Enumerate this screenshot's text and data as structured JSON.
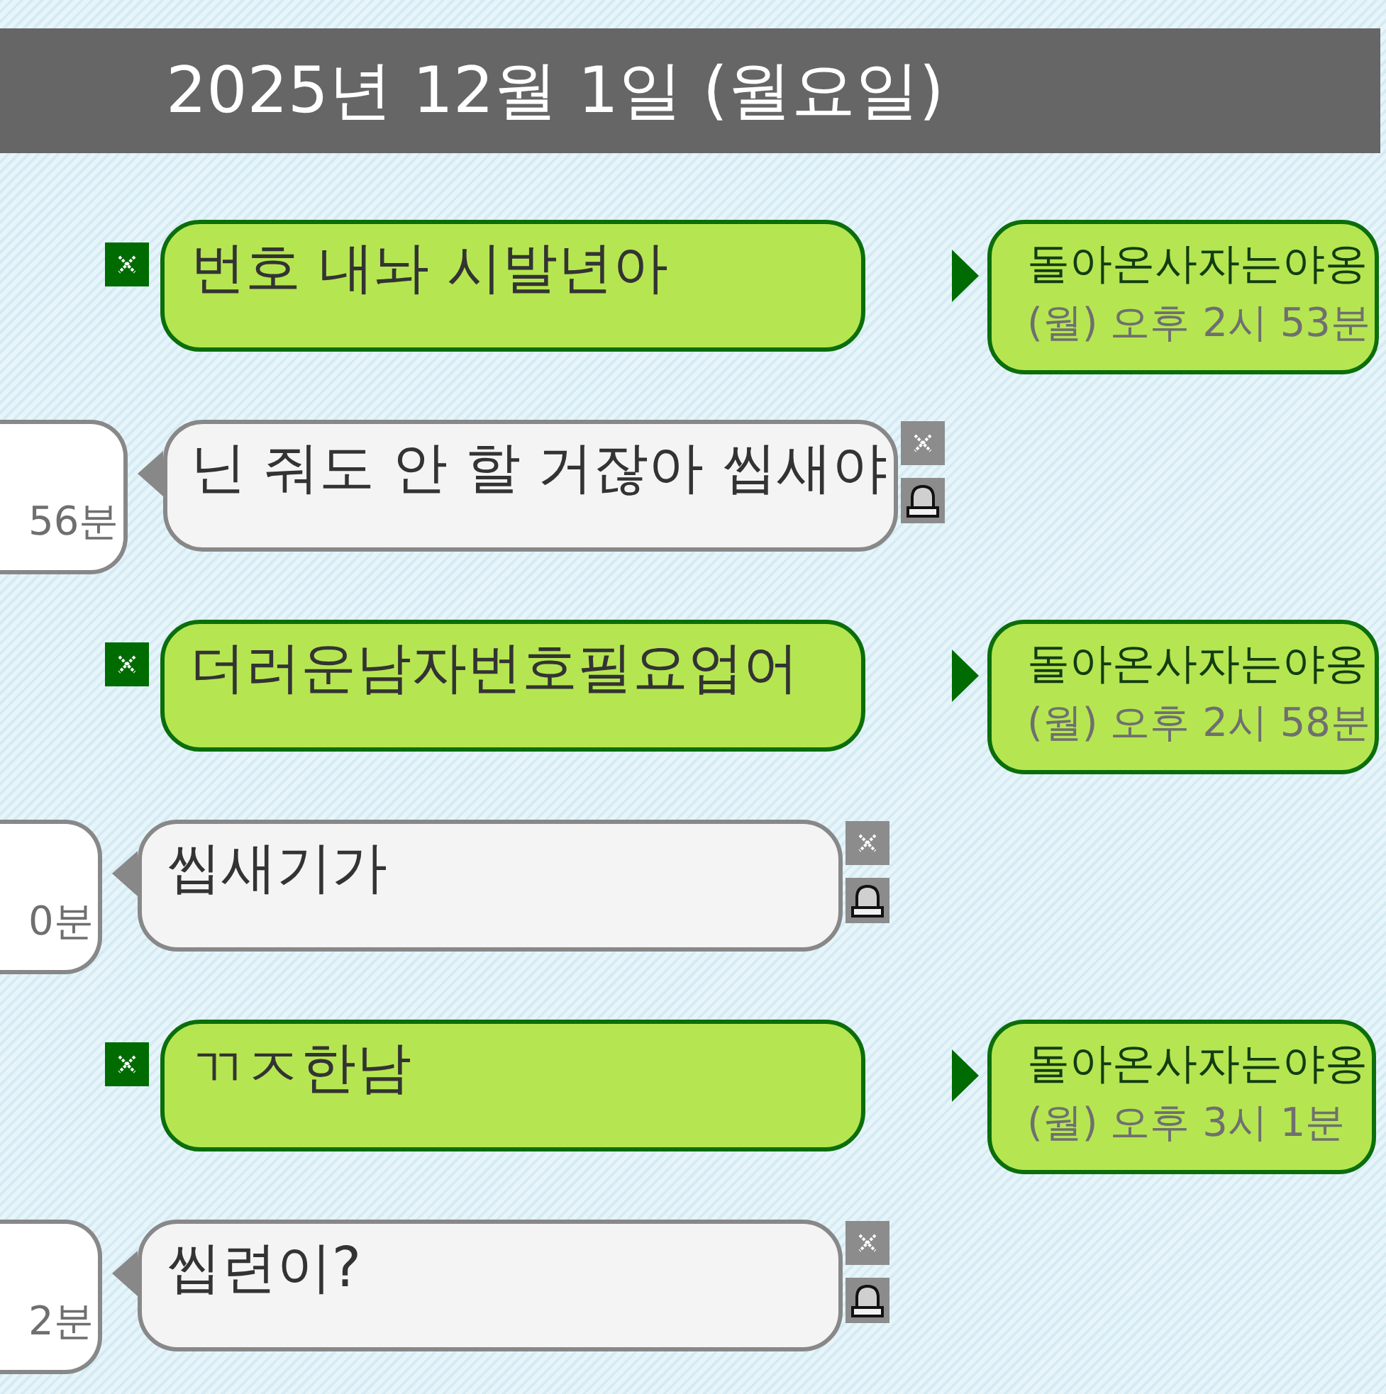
{
  "header": {
    "date": "2025년 12월 1일 (월요일)"
  },
  "messages": [
    {
      "kind": "sent",
      "text": "번호 내놔 시발년아",
      "sender": {
        "name": "돌아온사자는야옹",
        "time": "(월) 오후 2시 53분"
      }
    },
    {
      "kind": "received",
      "text": "닌 줘도 안 할 거잖아 씹새야",
      "sender": {
        "time": "56분"
      }
    },
    {
      "kind": "sent",
      "text": "더러운남자번호필요업어",
      "sender": {
        "name": "돌아온사자는야옹",
        "time": "(월) 오후 2시 58분"
      }
    },
    {
      "kind": "received",
      "text": "씹새기가",
      "sender": {
        "time": "0분"
      }
    },
    {
      "kind": "sent",
      "text": "ㄲㅈ한남",
      "sender": {
        "name": "돌아온사자는야옹",
        "time": "(월) 오후 3시 1분"
      }
    },
    {
      "kind": "received",
      "text": "씹련이?",
      "sender": {
        "time": "2분"
      }
    }
  ]
}
